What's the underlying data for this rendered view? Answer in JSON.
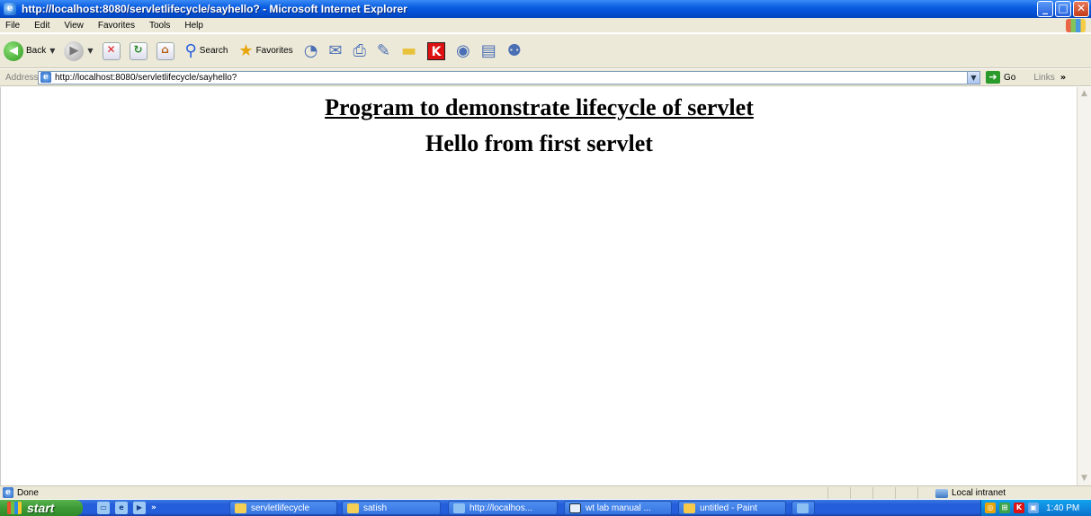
{
  "window": {
    "title": "http://localhost:8080/servletlifecycle/sayhello? - Microsoft Internet Explorer",
    "controls": [
      "_",
      "□",
      "✕"
    ]
  },
  "menu": [
    "File",
    "Edit",
    "View",
    "Favorites",
    "Tools",
    "Help"
  ],
  "toolbar": {
    "back_label": "Back",
    "search_label": "Search",
    "favorites_label": "Favorites"
  },
  "address": {
    "label": "Address",
    "url": "http://localhost:8080/servletlifecycle/sayhello?",
    "go_label": "Go",
    "links_label": "Links",
    "chevron": "»"
  },
  "page": {
    "heading": "Program to demonstrate lifecycle of servlet",
    "message": "Hello from first servlet"
  },
  "status": {
    "text": "Done",
    "zone": "Local intranet"
  },
  "taskbar": {
    "start_label": "start",
    "tasks": [
      {
        "label": "servletlifecycle",
        "icon": "folder-icon"
      },
      {
        "label": "satish",
        "icon": "folder-icon"
      },
      {
        "label": "http://localhos...",
        "icon": "ie-icon"
      },
      {
        "label": "wt lab manual ...",
        "icon": "word-icon"
      },
      {
        "label": "untitled - Paint",
        "icon": "paint-icon"
      }
    ],
    "clock": "1:40 PM"
  }
}
